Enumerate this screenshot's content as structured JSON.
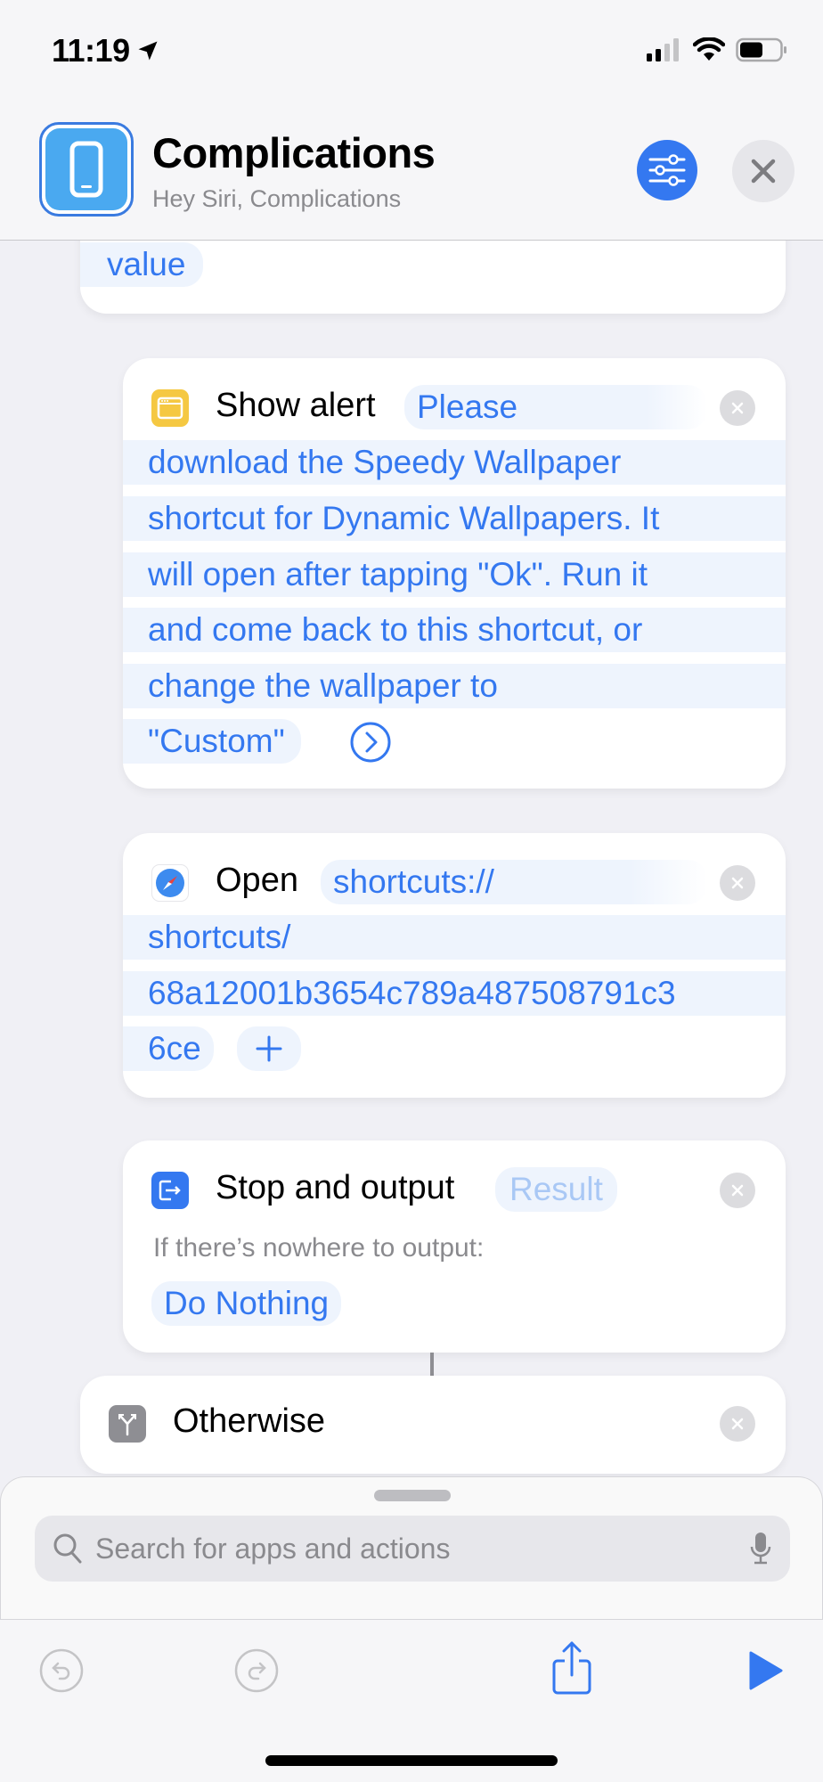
{
  "status_bar": {
    "time": "11:19",
    "location_icon": "location-arrow-icon",
    "signal_icon": "cellular-signal-icon",
    "wifi_icon": "wifi-icon",
    "battery_icon": "battery-icon"
  },
  "header": {
    "title": "Complications",
    "subtitle": "Hey Siri, Complications",
    "app_icon": "iphone-icon",
    "settings_icon": "sliders-icon",
    "close_icon": "close-icon",
    "accent_color": "#3478f0"
  },
  "actions": [
    {
      "id": "previous-tail",
      "token": "value"
    },
    {
      "id": "show-alert",
      "title": "Show alert",
      "icon": "alert-window-icon",
      "icon_color": "#f5c842",
      "first_token": "Please",
      "lines": [
        "download the Speedy Wallpaper",
        "shortcut for Dynamic Wallpapers. It",
        "will open after tapping \"Ok\". Run it",
        "and come back to this shortcut, or",
        "change the wallpaper to"
      ],
      "last_token": "\"Custom\"",
      "expand_icon": "chevron-right-circle-icon"
    },
    {
      "id": "open-url",
      "title": "Open",
      "icon": "safari-compass-icon",
      "first_token": "shortcuts://",
      "lines": [
        "shortcuts/",
        "68a12001b3654c789a487508791c3"
      ],
      "last_token": "6ce",
      "add_icon": "plus-icon"
    },
    {
      "id": "stop-output",
      "title": "Stop and output",
      "icon": "exit-icon",
      "icon_color": "#3478f0",
      "token": "Result",
      "label": "If there’s nowhere to output:",
      "option": "Do Nothing"
    },
    {
      "id": "otherwise",
      "title": "Otherwise",
      "icon": "branch-icon",
      "icon_color": "#8e8e93"
    }
  ],
  "search": {
    "placeholder": "Search for apps and actions",
    "search_icon": "magnifier-icon",
    "mic_icon": "microphone-icon"
  },
  "toolbar": {
    "undo_icon": "undo-icon",
    "redo_icon": "redo-icon",
    "share_icon": "share-icon",
    "run_icon": "play-icon"
  }
}
